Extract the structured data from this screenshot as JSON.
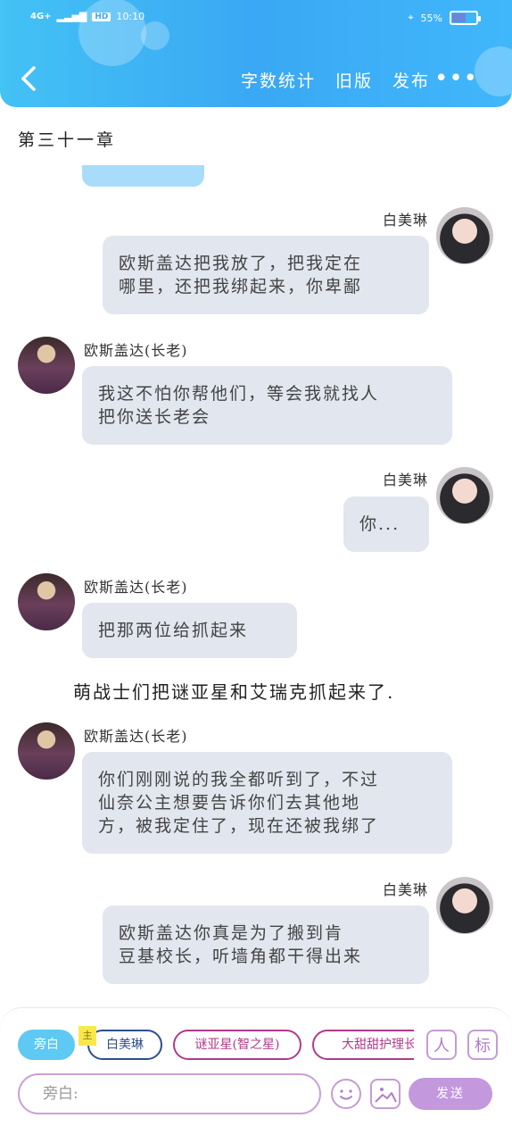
{
  "status_bar": {
    "network": "4G+",
    "hd": "HD",
    "time": "10:10",
    "battery": "55%"
  },
  "header": {
    "actions": [
      "字数统计",
      "旧版",
      "发布"
    ],
    "more": "•••"
  },
  "chapter_title": "第三十一章",
  "messages": [
    {
      "side": "right",
      "speaker": "白美琳",
      "text_lines": [
        "欧斯盖达把我放了，把我定在",
        "哪里，还把我绑起来，你卑鄙"
      ]
    },
    {
      "side": "left",
      "speaker": "欧斯盖达(长老)",
      "text_lines": [
        "我这不怕你帮他们，等会我就找人",
        "把你送长老会"
      ]
    },
    {
      "side": "right",
      "speaker": "白美琳",
      "text_lines": [
        "你..."
      ]
    },
    {
      "side": "left",
      "speaker": "欧斯盖达(长老)",
      "text_lines": [
        "把那两位给抓起来"
      ]
    },
    {
      "side": "narration",
      "text": "萌战士们把谜亚星和艾瑞克抓起来了."
    },
    {
      "side": "left",
      "speaker": "欧斯盖达(长老)",
      "text_lines": [
        "你们刚刚说的我全都听到了，不过",
        "仙奈公主想要告诉你们去其他地",
        "方，被我定住了，现在还被我绑了"
      ]
    },
    {
      "side": "right",
      "speaker": "白美琳",
      "text_lines": [
        "欧斯盖达你真是为了搬到肯",
        "豆基校长，听墙角都干得出来"
      ]
    }
  ],
  "composer": {
    "chips": [
      "旁白",
      "白美琳",
      "谜亚星(智之星)",
      "大甜甜护理长"
    ],
    "badge": "主",
    "icon_labels": [
      "人",
      "标"
    ],
    "input_placeholder": "旁白:",
    "send_label": "发送"
  }
}
